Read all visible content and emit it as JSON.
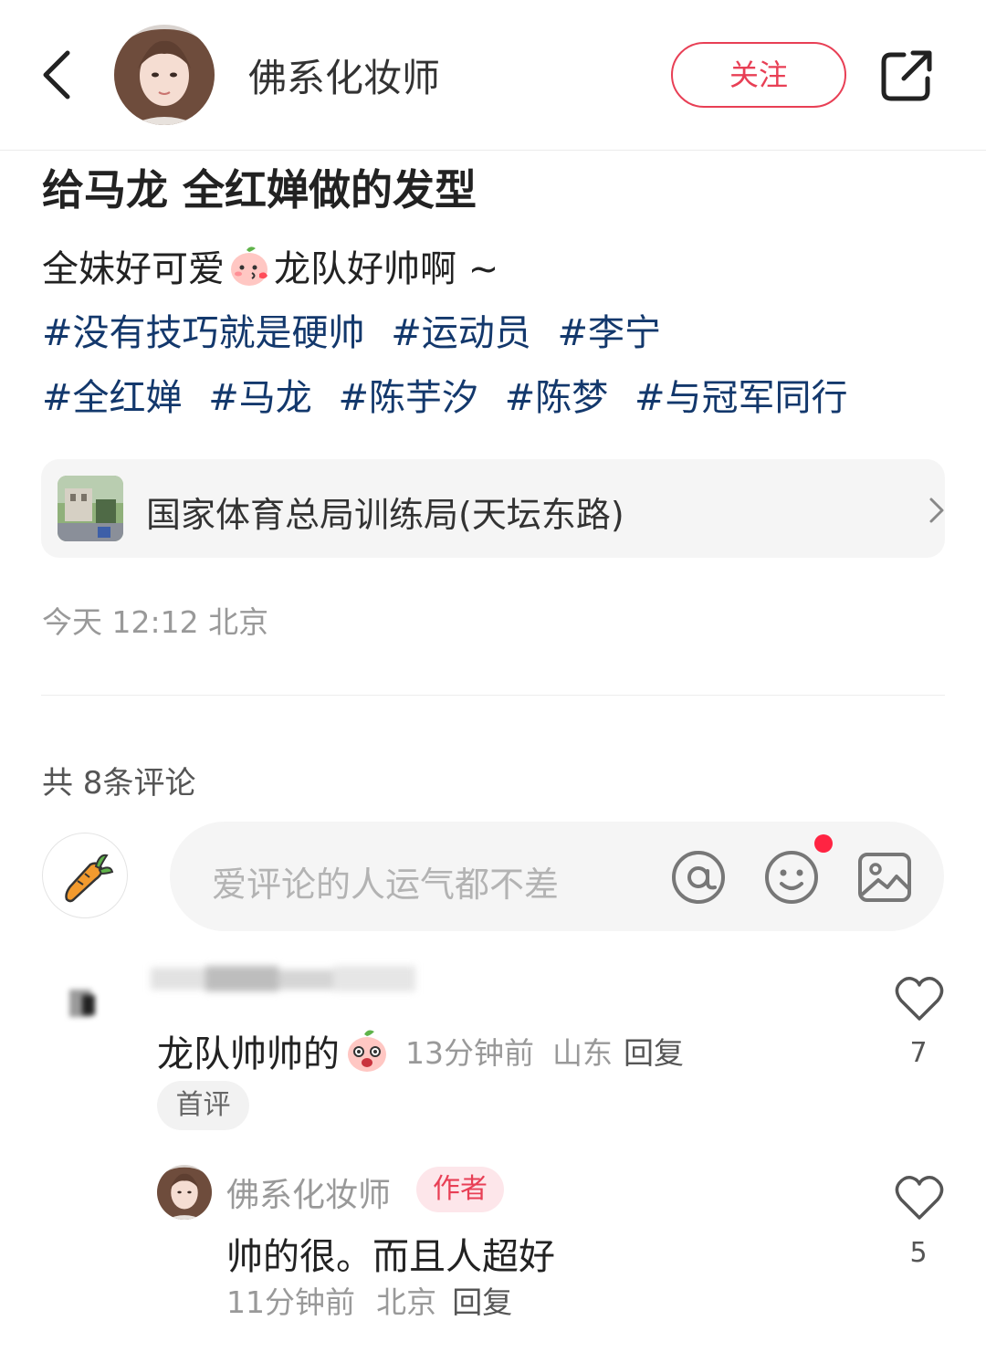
{
  "header": {
    "back_icon": "chevron-left-icon",
    "author_name": "佛系化妆师",
    "follow_label": "关注",
    "share_icon": "share-external-icon"
  },
  "post": {
    "title": "给马龙 全红婵做的发型",
    "body_before": "全妹好可爱",
    "body_emoji": "blushing-peach-emoji",
    "body_after": "龙队好帅啊 ~",
    "tags_line1": [
      "#没有技巧就是硬帅",
      "#运动员",
      "#李宁"
    ],
    "tags_line2": [
      "#全红婵",
      "#马龙",
      "#陈芋汐",
      "#陈梦",
      "#与冠军同行"
    ],
    "location": "国家体育总局训练局(天坛东路)",
    "meta": "今天 12:12 北京"
  },
  "comments_section": {
    "count_text": "共 8条评论",
    "my_avatar_icon": "carrot-icon",
    "input_placeholder": "爱评论的人运气都不差",
    "icons": [
      "at-icon",
      "emoji-smile-icon",
      "image-icon"
    ]
  },
  "comments": [
    {
      "text": "龙队帅帅的",
      "emoji": "surprised-peach-emoji",
      "time": "13分钟前",
      "region": "山东",
      "reply_label": "回复",
      "badge": "首评",
      "likes": "7"
    }
  ],
  "reply": {
    "name": "佛系化妆师",
    "badge": "作者",
    "text": "帅的很。而且人超好",
    "time": "11分钟前",
    "region": "北京",
    "reply_label": "回复",
    "likes": "5"
  },
  "colors": {
    "accent": "#e83f55",
    "tag": "#13386c",
    "muted": "#999999",
    "notification_dot": "#ff2442"
  }
}
